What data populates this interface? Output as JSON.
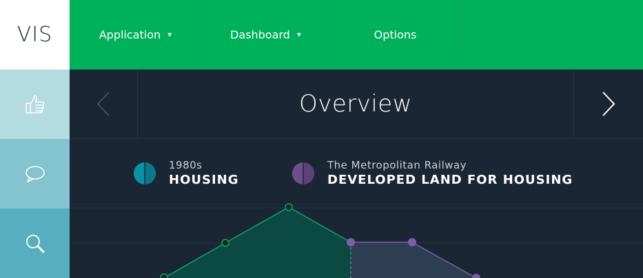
{
  "app": {
    "logo": "VIS"
  },
  "topnav": {
    "items": [
      {
        "label": "Application",
        "has_caret": true
      },
      {
        "label": "Dashboard",
        "has_caret": true
      },
      {
        "label": "Options",
        "has_caret": false
      }
    ]
  },
  "sidebar": {
    "items": [
      {
        "icon": "thumbs-up-icon"
      },
      {
        "icon": "speech-bubble-icon"
      },
      {
        "icon": "search-icon"
      }
    ]
  },
  "overview": {
    "title": "Overview",
    "prev_icon": "chevron-left-icon",
    "next_icon": "chevron-right-icon"
  },
  "legend": [
    {
      "sub": "1980s",
      "main": "HOUSING",
      "color": "#0a93a6"
    },
    {
      "sub": "The Metropolitan Railway",
      "main": "DEVELOPED LAND FOR HOUSING",
      "color": "#6d4f8e"
    }
  ],
  "colors": {
    "nav_green": "#00b15c",
    "background": "#1a2634",
    "housing_line": "#13a16a",
    "housing_fill": "#0b4a43",
    "railway_line": "#7c5ea8",
    "railway_fill": "#2e3e52"
  }
}
